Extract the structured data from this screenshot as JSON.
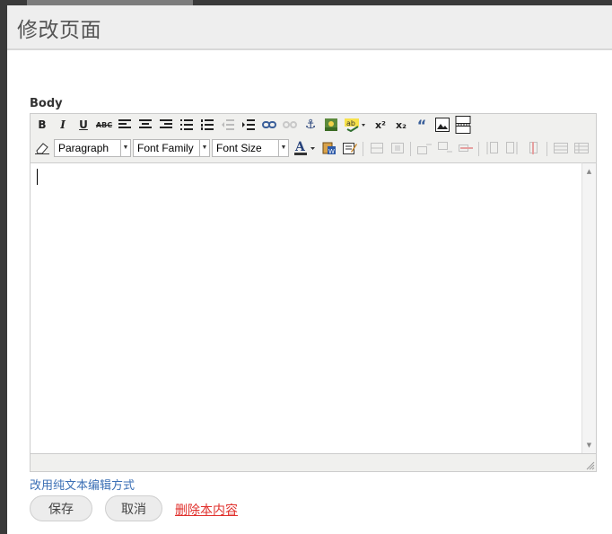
{
  "dialog": {
    "title": "修改页面"
  },
  "form": {
    "body_label": "Body"
  },
  "toolbar": {
    "row1": [
      {
        "name": "bold-icon",
        "glyph": "B",
        "disabled": false
      },
      {
        "name": "italic-icon",
        "glyph": "I",
        "disabled": false
      },
      {
        "name": "underline-icon",
        "glyph": "U",
        "disabled": false
      },
      {
        "name": "strikethrough-icon",
        "glyph": "ABC",
        "disabled": false
      },
      {
        "name": "align-left-icon",
        "glyph": "≡",
        "disabled": false
      },
      {
        "name": "align-center-icon",
        "glyph": "≡",
        "disabled": false
      },
      {
        "name": "align-right-icon",
        "glyph": "≡",
        "disabled": false
      },
      {
        "name": "bullet-list-icon",
        "glyph": "☰",
        "disabled": false
      },
      {
        "name": "numbered-list-icon",
        "glyph": "☰",
        "disabled": false
      },
      {
        "name": "outdent-icon",
        "glyph": "⇤",
        "disabled": true
      },
      {
        "name": "indent-icon",
        "glyph": "⇥",
        "disabled": false
      },
      {
        "name": "link-icon",
        "glyph": "⛓",
        "disabled": false
      },
      {
        "name": "unlink-icon",
        "glyph": "⛓",
        "disabled": true
      },
      {
        "name": "anchor-icon",
        "glyph": "⚓",
        "disabled": false
      },
      {
        "name": "image-icon",
        "glyph": "▣",
        "disabled": false
      },
      {
        "name": "spellcheck-icon",
        "glyph": "ab",
        "disabled": false
      },
      {
        "name": "superscript-icon",
        "glyph": "x²",
        "disabled": false
      },
      {
        "name": "subscript-icon",
        "glyph": "x₂",
        "disabled": false
      },
      {
        "name": "blockquote-icon",
        "glyph": "“",
        "disabled": false
      },
      {
        "name": "insert-image-icon",
        "glyph": "▣",
        "disabled": false
      },
      {
        "name": "page-break-icon",
        "glyph": "⊟",
        "disabled": false
      }
    ],
    "format_select": "Paragraph",
    "font_family_select": "Font Family",
    "font_size_select": "Font Size",
    "row2_icons": [
      {
        "name": "eraser-icon"
      },
      {
        "name": "text-color-icon"
      },
      {
        "name": "paste-word-icon"
      },
      {
        "name": "edit-source-icon"
      },
      {
        "name": "table-icon"
      },
      {
        "name": "table-cell-icon"
      },
      {
        "name": "insert-row-before-icon"
      },
      {
        "name": "insert-row-after-icon"
      },
      {
        "name": "delete-row-icon"
      },
      {
        "name": "insert-column-before-icon"
      },
      {
        "name": "insert-column-after-icon"
      },
      {
        "name": "delete-column-icon"
      },
      {
        "name": "merge-cells-icon"
      },
      {
        "name": "split-cells-icon"
      }
    ]
  },
  "links": {
    "plain_text_mode": "改用纯文本编辑方式",
    "delete_content": "删除本内容"
  },
  "buttons": {
    "save": "保存",
    "cancel": "取消"
  },
  "colors": {
    "link_blue": "#3b6fb5",
    "delete_red": "#e0302c",
    "header_bg": "#eeeeee"
  }
}
